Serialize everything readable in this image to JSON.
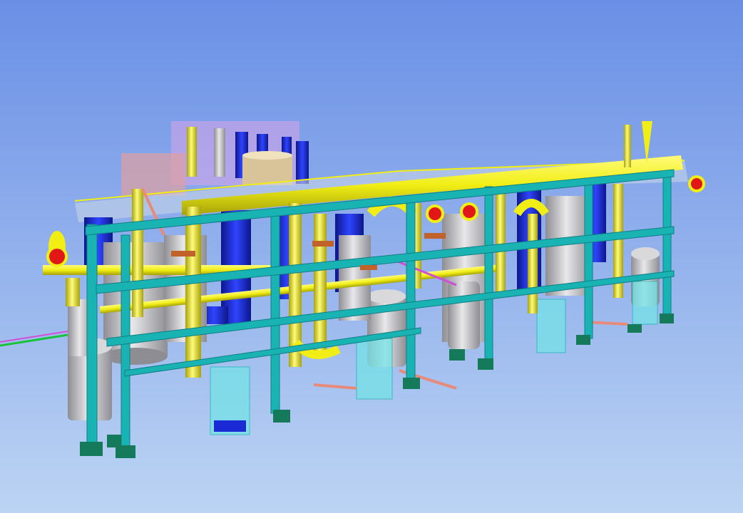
{
  "viewport": {
    "background": {
      "top": "#6a8fe6",
      "bottom": "#bcd4f3"
    }
  },
  "palette": {
    "steel_frame": "#1ab3b3",
    "steel_dark": "#0e7f84",
    "footing": "#147a5a",
    "pipe_yellow": "#f1ee15",
    "pipe_yellow_shade": "#b8b40c",
    "vessel_grey": "#c9c9cc",
    "vessel_shade": "#8d8d93",
    "tank_blue": "#1a2bd6",
    "glass_cyan": "#74e2e6",
    "red_accent": "#e21818",
    "salmon_pipe": "#e88a7a",
    "magenta_rail": "#d14fd6",
    "green_line": "#19c23b",
    "rust_fitting": "#c0622a"
  },
  "scene": {
    "subject": "industrial-plant-3d-model",
    "elements": [
      "steel-structure",
      "yellow-process-pipes",
      "grey-pressure-vessels",
      "blue-tanks",
      "cyan-enclosures",
      "red-flanges",
      "green-footings",
      "distant-units"
    ]
  }
}
